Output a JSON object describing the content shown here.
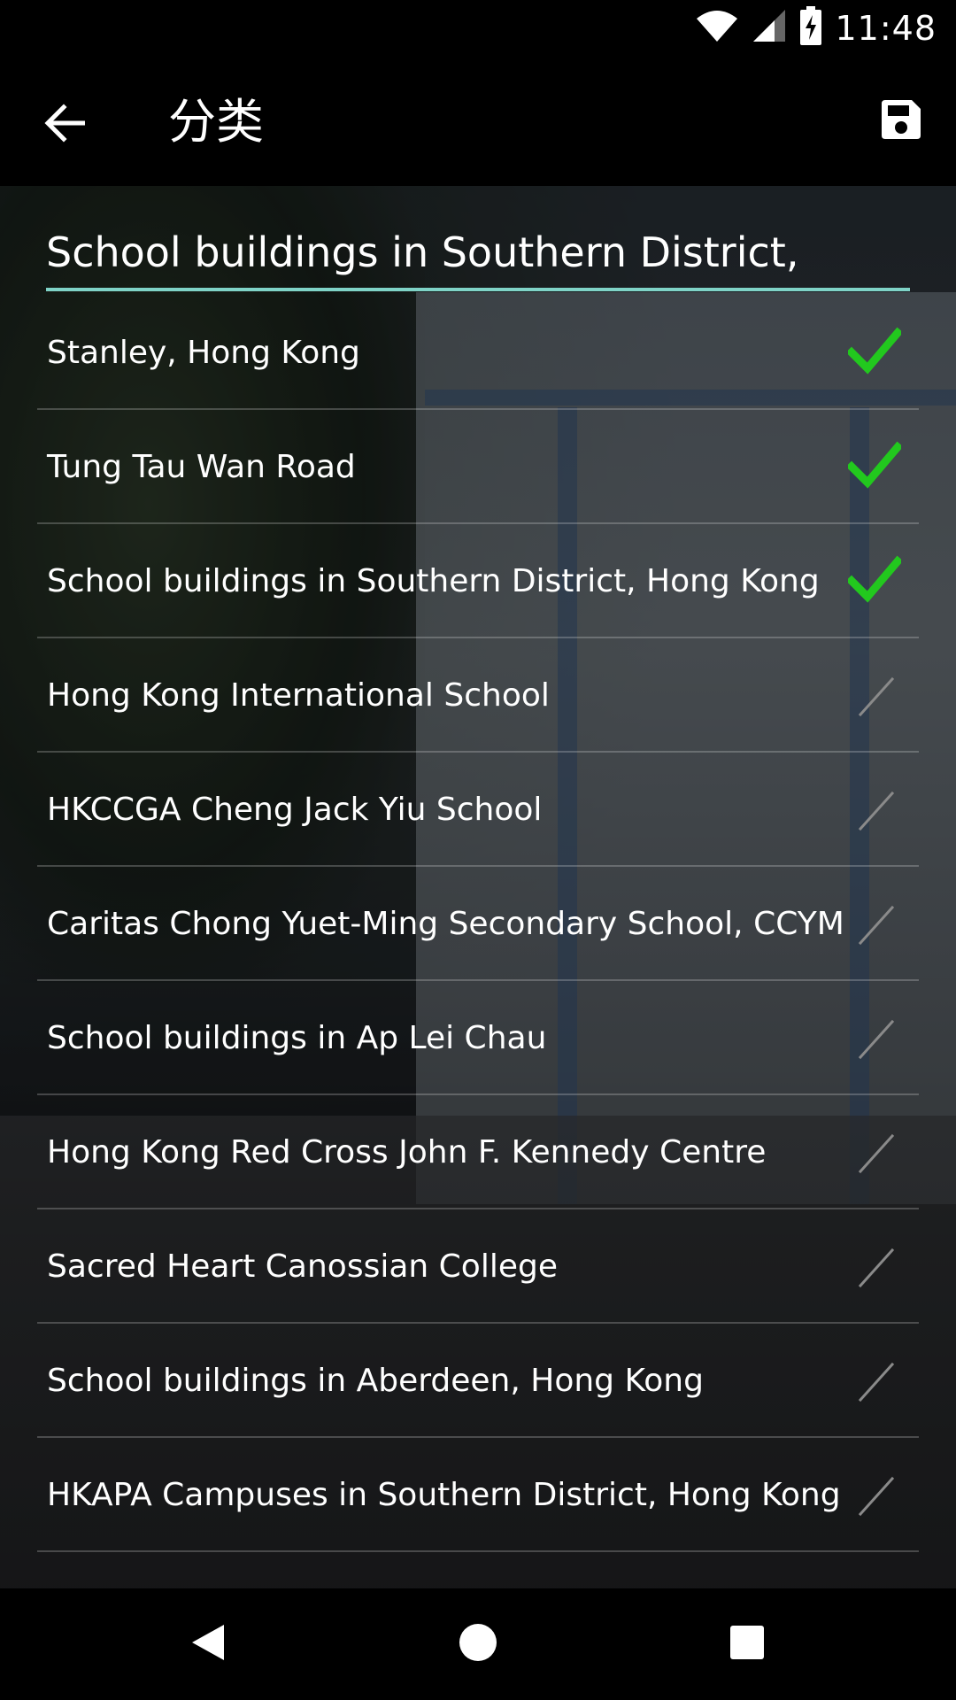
{
  "status_bar": {
    "time": "11:48",
    "icons": [
      "wifi-icon",
      "signal-icon",
      "battery-charging-icon"
    ]
  },
  "toolbar": {
    "title": "分类",
    "back_icon": "arrow-left-icon",
    "save_icon": "save-icon"
  },
  "search": {
    "value": "School buildings in Southern District, Hong Kong",
    "underline_color": "#7fd3c7"
  },
  "categories": [
    {
      "label": "Stanley, Hong Kong",
      "checked": true
    },
    {
      "label": "Tung Tau Wan Road",
      "checked": true
    },
    {
      "label": "School buildings in Southern District, Hong Kong",
      "checked": true
    },
    {
      "label": "Hong Kong International School",
      "checked": false
    },
    {
      "label": "HKCCGA Cheng Jack Yiu School",
      "checked": false
    },
    {
      "label": "Caritas Chong Yuet-Ming Secondary School, CCYM",
      "checked": false
    },
    {
      "label": "School buildings in Ap Lei Chau",
      "checked": false
    },
    {
      "label": "Hong Kong Red Cross John F. Kennedy Centre",
      "checked": false
    },
    {
      "label": "Sacred Heart Canossian College",
      "checked": false
    },
    {
      "label": "School buildings in Aberdeen, Hong Kong",
      "checked": false
    },
    {
      "label": "HKAPA Campuses in Southern District, Hong Kong",
      "checked": false
    }
  ],
  "colors": {
    "check_on": "#22c81e",
    "check_off": "#8a8a8a"
  },
  "nav_bar": {
    "icons": [
      "back-triangle-icon",
      "home-circle-icon",
      "recents-square-icon"
    ]
  }
}
